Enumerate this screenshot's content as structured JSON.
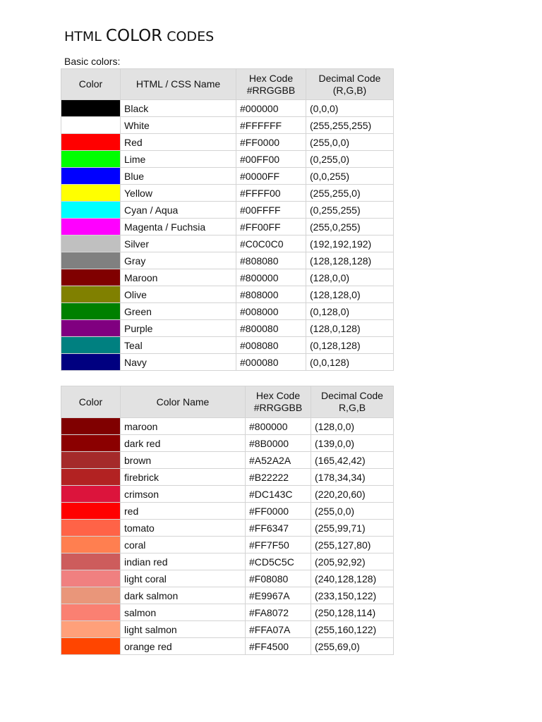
{
  "title": {
    "part1": "HTML ",
    "part2": "COLOR",
    "part3": " CODES"
  },
  "subtitle": "Basic colors:",
  "basic_table": {
    "headers": [
      "Color",
      "HTML / CSS Name",
      "Hex Code\n#RRGGBB",
      "Decimal Code\n(R,G,B)"
    ],
    "rows": [
      {
        "name": "Black",
        "hex": "#000000",
        "dec": "(0,0,0)"
      },
      {
        "name": "White",
        "hex": "#FFFFFF",
        "dec": "(255,255,255)"
      },
      {
        "name": "Red",
        "hex": "#FF0000",
        "dec": "(255,0,0)"
      },
      {
        "name": "Lime",
        "hex": "#00FF00",
        "dec": "(0,255,0)"
      },
      {
        "name": "Blue",
        "hex": "#0000FF",
        "dec": "(0,0,255)"
      },
      {
        "name": "Yellow",
        "hex": "#FFFF00",
        "dec": "(255,255,0)"
      },
      {
        "name": "Cyan / Aqua",
        "hex": "#00FFFF",
        "dec": "(0,255,255)"
      },
      {
        "name": "Magenta / Fuchsia",
        "hex": "#FF00FF",
        "dec": "(255,0,255)"
      },
      {
        "name": "Silver",
        "hex": "#C0C0C0",
        "dec": "(192,192,192)"
      },
      {
        "name": "Gray",
        "hex": "#808080",
        "dec": "(128,128,128)"
      },
      {
        "name": "Maroon",
        "hex": "#800000",
        "dec": "(128,0,0)"
      },
      {
        "name": "Olive",
        "hex": "#808000",
        "dec": "(128,128,0)"
      },
      {
        "name": "Green",
        "hex": "#008000",
        "dec": "(0,128,0)"
      },
      {
        "name": "Purple",
        "hex": "#800080",
        "dec": "(128,0,128)"
      },
      {
        "name": "Teal",
        "hex": "#008080",
        "dec": "(0,128,128)"
      },
      {
        "name": "Navy",
        "hex": "#000080",
        "dec": "(0,0,128)"
      }
    ]
  },
  "red_table": {
    "headers": [
      "Color",
      "Color Name",
      "Hex Code\n#RRGGBB",
      "Decimal Code\nR,G,B"
    ],
    "rows": [
      {
        "name": "maroon",
        "hex": "#800000",
        "dec": "(128,0,0)"
      },
      {
        "name": "dark red",
        "hex": "#8B0000",
        "dec": "(139,0,0)"
      },
      {
        "name": "brown",
        "hex": "#A52A2A",
        "dec": "(165,42,42)"
      },
      {
        "name": "firebrick",
        "hex": "#B22222",
        "dec": "(178,34,34)"
      },
      {
        "name": "crimson",
        "hex": "#DC143C",
        "dec": "(220,20,60)"
      },
      {
        "name": "red",
        "hex": "#FF0000",
        "dec": "(255,0,0)"
      },
      {
        "name": "tomato",
        "hex": "#FF6347",
        "dec": "(255,99,71)"
      },
      {
        "name": "coral",
        "hex": "#FF7F50",
        "dec": "(255,127,80)"
      },
      {
        "name": "indian red",
        "hex": "#CD5C5C",
        "dec": "(205,92,92)"
      },
      {
        "name": "light coral",
        "hex": "#F08080",
        "dec": "(240,128,128)"
      },
      {
        "name": "dark salmon",
        "hex": "#E9967A",
        "dec": "(233,150,122)"
      },
      {
        "name": "salmon",
        "hex": "#FA8072",
        "dec": "(250,128,114)"
      },
      {
        "name": "light salmon",
        "hex": "#FFA07A",
        "dec": "(255,160,122)"
      },
      {
        "name": "orange red",
        "hex": "#FF4500",
        "dec": "(255,69,0)"
      }
    ]
  }
}
